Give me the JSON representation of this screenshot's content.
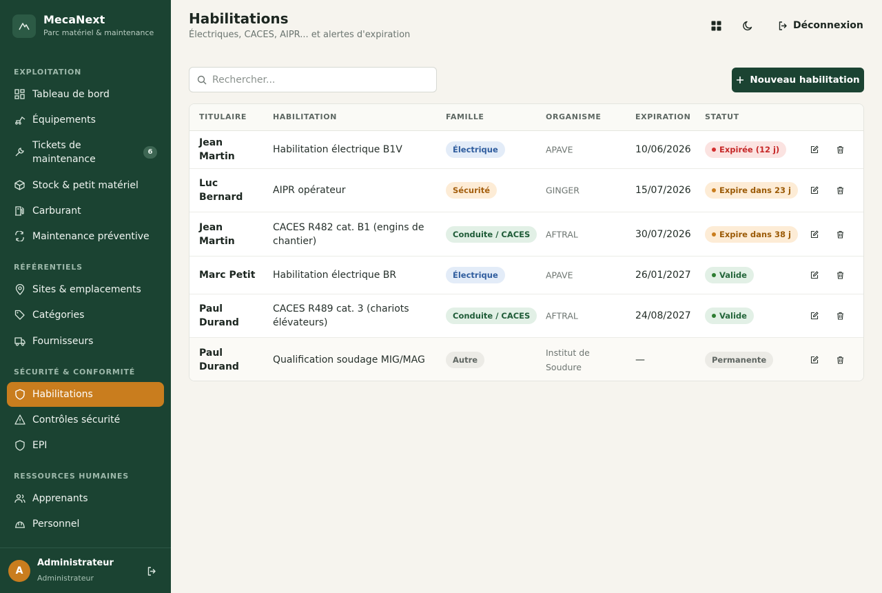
{
  "brand": {
    "name": "MecaNext",
    "subtitle": "Parc matériel & maintenance"
  },
  "sidebar": {
    "sections": [
      {
        "label": "EXPLOITATION"
      },
      {
        "label": "RÉFÉRENTIELS"
      },
      {
        "label": "SÉCURITÉ & CONFORMITÉ"
      },
      {
        "label": "RESSOURCES HUMAINES"
      }
    ],
    "items": [
      {
        "label": "Tableau de bord",
        "icon": "dashboard-icon"
      },
      {
        "label": "Équipements",
        "icon": "excavator-icon"
      },
      {
        "label": "Tickets de maintenance",
        "icon": "wrench-icon",
        "badge": "6"
      },
      {
        "label": "Stock & petit matériel",
        "icon": "box-icon"
      },
      {
        "label": "Carburant",
        "icon": "fuel-icon"
      },
      {
        "label": "Maintenance préventive",
        "icon": "cycle-icon"
      },
      {
        "label": "Sites & emplacements",
        "icon": "map-pin-icon"
      },
      {
        "label": "Catégories",
        "icon": "tag-icon"
      },
      {
        "label": "Fournisseurs",
        "icon": "truck-icon"
      },
      {
        "label": "Habilitations",
        "icon": "shield-icon",
        "active": true
      },
      {
        "label": "Contrôles sécurité",
        "icon": "warning-icon"
      },
      {
        "label": "EPI",
        "icon": "shield-icon"
      },
      {
        "label": "Apprenants",
        "icon": "users-icon"
      },
      {
        "label": "Personnel",
        "icon": "hardhat-icon"
      }
    ]
  },
  "user": {
    "initial": "A",
    "name": "Administrateur",
    "role": "Administrateur"
  },
  "header": {
    "title": "Habilitations",
    "subtitle": "Électriques, CACES, AIPR... et alertes d'expiration",
    "logout_label": "Déconnexion"
  },
  "toolbar": {
    "search_placeholder": "Rechercher...",
    "new_label": "Nouveau habilitation"
  },
  "table": {
    "headers": {
      "holder": "TITULAIRE",
      "habilitation": "HABILITATION",
      "family": "FAMILLE",
      "organism": "ORGANISME",
      "expiration": "EXPIRATION",
      "status": "STATUT"
    },
    "rows": [
      {
        "holder": "Jean Martin",
        "habilitation": "Habilitation électrique B1V",
        "family": "Électrique",
        "organism": "APAVE",
        "expiration": "10/06/2026",
        "status": "Expirée (12 j)"
      },
      {
        "holder": "Luc Bernard",
        "habilitation": "AIPR opérateur",
        "family": "Sécurité",
        "organism": "GINGER",
        "expiration": "15/07/2026",
        "status": "Expire dans 23 j"
      },
      {
        "holder": "Jean Martin",
        "habilitation": "CACES R482 cat. B1 (engins de chantier)",
        "family": "Conduite / CACES",
        "organism": "AFTRAL",
        "expiration": "30/07/2026",
        "status": "Expire dans 38 j"
      },
      {
        "holder": "Marc Petit",
        "habilitation": "Habilitation électrique BR",
        "family": "Électrique",
        "organism": "APAVE",
        "expiration": "26/01/2027",
        "status": "Valide"
      },
      {
        "holder": "Paul Durand",
        "habilitation": "CACES R489 cat. 3 (chariots élévateurs)",
        "family": "Conduite / CACES",
        "organism": "AFTRAL",
        "expiration": "24/08/2027",
        "status": "Valide"
      },
      {
        "holder": "Paul Durand",
        "habilitation": "Qualification soudage MIG/MAG",
        "family": "Autre",
        "organism": "Institut de Soudure",
        "expiration": "—",
        "status": "Permanente"
      }
    ]
  },
  "colors": {
    "sidebar_bg": "#1b4332",
    "accent": "#c97d1e",
    "primary_button": "#1b4332",
    "status_expired": "#c62828",
    "status_warning": "#b26a00",
    "status_valid": "#2e7d32"
  }
}
